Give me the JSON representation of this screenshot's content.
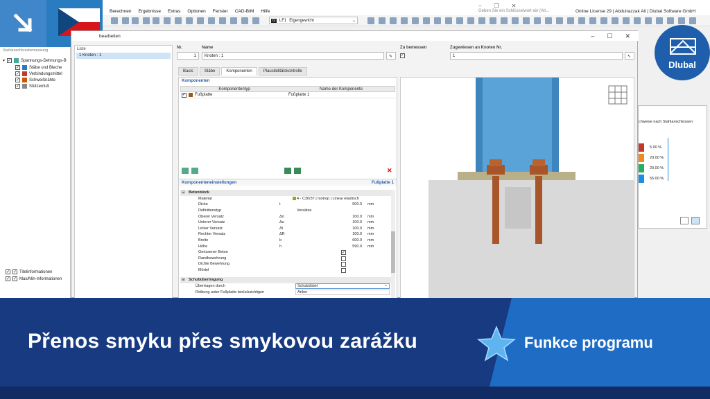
{
  "menu": {
    "items": [
      "Berechnen",
      "Ergebnisse",
      "Extras",
      "Optionen",
      "Fenster",
      "CAD-BIM",
      "Hilfe"
    ],
    "search_placeholder": "Geben Sie ein Schlüsselwort ein (Alt...",
    "license": "Online License 29 | Abdulrazzak Ali | Dlubal Software GmbH",
    "lc_badge": "G",
    "lc_id": "LF1",
    "lc_name": "Eigengewicht"
  },
  "navigator": {
    "header": "Stahlanschlussbemessung",
    "root": "Spannungs-Dehnungs-B",
    "items": [
      "Stäbe und Bleche",
      "Verbindungsmittel",
      "Schweißnähte",
      "Stützenfuß"
    ],
    "bottom_items": [
      "Titelinformationen",
      "Max/Min-Informationen"
    ]
  },
  "dialog": {
    "title": "bearbeiten",
    "list_header": "Liste",
    "list_item": "1  Knoten : 1",
    "nr_label": "Nr.",
    "nr_value": "1",
    "name_label": "Name",
    "name_value": "Knoten : 1",
    "design_label": "Zu bemessen",
    "assigned_label": "Zugewiesen an Knoten Nr.",
    "assigned_value": "1",
    "tabs": [
      "Basis",
      "Stäbe",
      "Komponenten",
      "Plausibilitätskontrolle"
    ],
    "components_title": "Komponenten",
    "col_type": "Komponententyp",
    "col_name": "Name der Komponente",
    "component_type": "Fußplatte",
    "component_name": "Fußplatte 1",
    "settings_title": "Komponenteneinstellungen",
    "settings_target": "Fußplatte 1",
    "group_concrete": "Betonblock",
    "group_shear": "Schubübertragung",
    "props": [
      {
        "name": "Material",
        "sym": "",
        "val": "4 - C30/37 | Isotrop | Linear elastisch",
        "num": "",
        "unit": ""
      },
      {
        "name": "Dicke",
        "sym": "t",
        "val": "",
        "num": "500.0",
        "unit": "mm"
      },
      {
        "name": "Definitionstyp",
        "sym": "",
        "val": "Versätze",
        "num": "",
        "unit": ""
      },
      {
        "name": "Oberer Versatz",
        "sym": "Δo",
        "val": "",
        "num": "100.0",
        "unit": "mm"
      },
      {
        "name": "Unterer Versatz",
        "sym": "Δu",
        "val": "",
        "num": "100.0",
        "unit": "mm"
      },
      {
        "name": "Linker Versatz",
        "sym": "Δl",
        "val": "",
        "num": "100.0",
        "unit": "mm"
      },
      {
        "name": "Rechter Versatz",
        "sym": "ΔR",
        "val": "",
        "num": "100.0",
        "unit": "mm"
      },
      {
        "name": "Breite",
        "sym": "b",
        "val": "",
        "num": "600.0",
        "unit": "mm"
      },
      {
        "name": "Höhe",
        "sym": "h",
        "val": "",
        "num": "590.0",
        "unit": "mm"
      }
    ],
    "checks": [
      {
        "name": "Gerissener Beton",
        "checked": true
      },
      {
        "name": "Randbewehrung",
        "checked": false
      },
      {
        "name": "Dichte Bewehrung",
        "checked": false
      },
      {
        "name": "Mörtel",
        "checked": false
      }
    ],
    "shear_rows": [
      "Übertragen durch",
      "Reibung unter Fußplatte berücksichtigen"
    ],
    "shear_value": "Schubdübel",
    "shear_option": "Anker"
  },
  "right_panel": {
    "title": "chweise nach Stahlanschlüssen",
    "legend": [
      {
        "value": "5.00 %",
        "color": "#c0392b"
      },
      {
        "value": "20.00 %",
        "color": "#f08a1c"
      },
      {
        "value": "20.00 %",
        "color": "#27ae60"
      },
      {
        "value": "55.00 %",
        "color": "#1e8fe0"
      }
    ]
  },
  "logo": {
    "text": "Dlubal"
  },
  "banner": {
    "title": "Přenos smyku přes smykovou zarážku",
    "subtitle": "Funkce programu"
  }
}
